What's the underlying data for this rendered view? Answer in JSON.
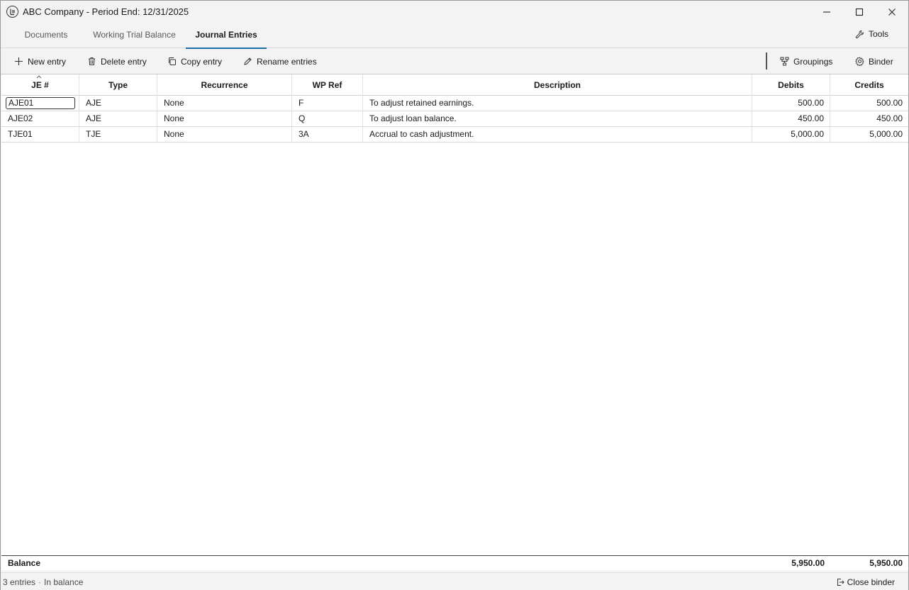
{
  "window": {
    "title": "ABC Company - Period End: 12/31/2025"
  },
  "tabs": [
    {
      "label": "Documents",
      "active": false
    },
    {
      "label": "Working Trial Balance",
      "active": false
    },
    {
      "label": "Journal Entries",
      "active": true
    }
  ],
  "tools_label": "Tools",
  "toolbar": {
    "new_entry": "New entry",
    "delete_entry": "Delete entry",
    "copy_entry": "Copy entry",
    "rename_entries": "Rename entries",
    "groupings": "Groupings",
    "binder": "Binder"
  },
  "grid": {
    "columns": [
      "JE #",
      "Type",
      "Recurrence",
      "WP Ref",
      "Description",
      "Debits",
      "Credits"
    ],
    "rows": [
      {
        "je": "AJE01",
        "type": "AJE",
        "recurrence": "None",
        "wp_ref": "F",
        "description": "To adjust retained earnings.",
        "debits": "500.00",
        "credits": "500.00"
      },
      {
        "je": "AJE02",
        "type": "AJE",
        "recurrence": "None",
        "wp_ref": "Q",
        "description": "To adjust loan balance.",
        "debits": "450.00",
        "credits": "450.00"
      },
      {
        "je": "TJE01",
        "type": "TJE",
        "recurrence": "None",
        "wp_ref": "3A",
        "description": "Accrual to cash adjustment.",
        "debits": "5,000.00",
        "credits": "5,000.00"
      }
    ]
  },
  "balance": {
    "label": "Balance",
    "debits": "5,950.00",
    "credits": "5,950.00"
  },
  "status": {
    "entries": "3 entries",
    "state": "In balance",
    "close_binder": "Close binder"
  },
  "colors": {
    "accent": "#1a6fa8"
  }
}
